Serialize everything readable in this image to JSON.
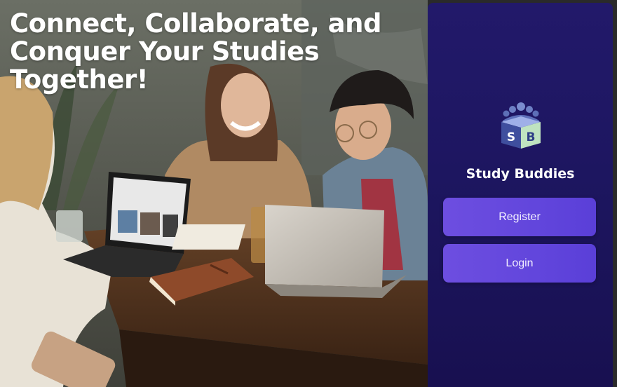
{
  "hero": {
    "headline_lines": [
      "Connect, Collaborate, and",
      "Conquer Your Studies",
      "Together!"
    ]
  },
  "panel": {
    "logo_letters": [
      "S",
      "B"
    ],
    "brand_name": "Study Buddies",
    "register_label": "Register",
    "login_label": "Login"
  },
  "colors": {
    "panel_bg": "#1d1660",
    "button_bg": "#6246dc",
    "logo_blue": "#3f4f9e",
    "logo_green": "#bfe3c0"
  }
}
